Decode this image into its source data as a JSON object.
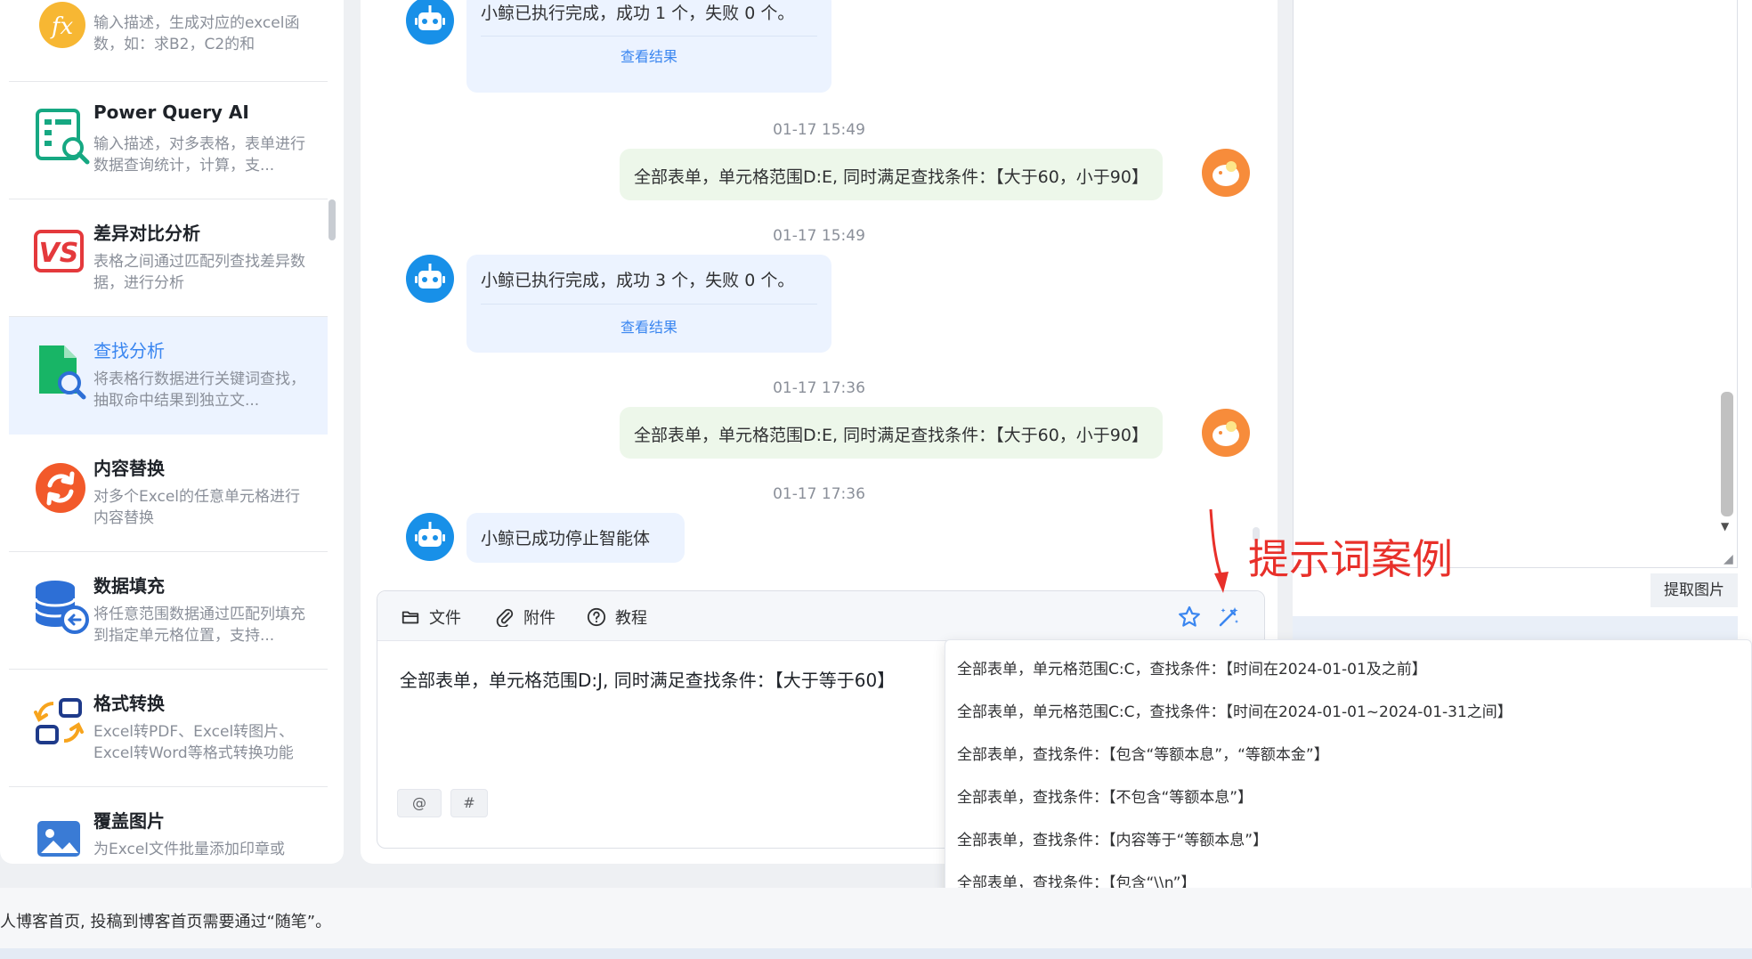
{
  "sidebar": {
    "items": [
      {
        "title": "",
        "desc": "输入描述，生成对应的excel函数，如：求B2，C2的和",
        "icon": "fx-icon",
        "color": "#f7b733"
      },
      {
        "title": "Power Query AI",
        "desc": "输入描述，对多表格，表单进行数据查询统计，计算，支...",
        "icon": "data-query-icon",
        "color": "#16a882"
      },
      {
        "title": "差异对比分析",
        "desc": "表格之间通过匹配列查找差异数据，进行分析",
        "icon": "vs-icon",
        "color": "#e4393c"
      },
      {
        "title": "查找分析",
        "desc": "将表格行数据进行关键词查找，抽取命中结果到独立文...",
        "icon": "file-search-icon",
        "color": "#18b566"
      },
      {
        "title": "内容替换",
        "desc": "对多个Excel的任意单元格进行内容替换",
        "icon": "refresh-icon",
        "color": "#f2592a"
      },
      {
        "title": "数据填充",
        "desc": "将任意范围数据通过匹配列填充到指定单元格位置，支持...",
        "icon": "database-icon",
        "color": "#2d6fd6"
      },
      {
        "title": "格式转换",
        "desc": "Excel转PDF、Excel转图片、Excel转Word等格式转换功能",
        "icon": "convert-icon",
        "color": "#1e3a8a"
      },
      {
        "title": "覆盖图片",
        "desc": "为Excel文件批量添加印章或",
        "icon": "image-icon",
        "color": "#3a7bd5"
      }
    ]
  },
  "chat": {
    "messages": [
      {
        "type": "bot",
        "text": "小鲸已执行完成，成功 1 个，失败 0 个。",
        "link": "查看结果"
      },
      {
        "type": "time",
        "text": "01-17 15:49"
      },
      {
        "type": "user",
        "text": "全部表单，单元格范围D:E, 同时满足查找条件：【大于60，小于90】"
      },
      {
        "type": "time",
        "text": "01-17 15:49"
      },
      {
        "type": "bot",
        "text": "小鲸已执行完成，成功 3 个，失败 0 个。",
        "link": "查看结果"
      },
      {
        "type": "time",
        "text": "01-17 17:36"
      },
      {
        "type": "user",
        "text": "全部表单，单元格范围D:E, 同时满足查找条件：【大于60，小于90】"
      },
      {
        "type": "time",
        "text": "01-17 17:36"
      },
      {
        "type": "bot",
        "text": "小鲸已成功停止智能体"
      }
    ],
    "toolbar": {
      "file": "文件",
      "attachment": "附件",
      "tutorial": "教程"
    },
    "input_value": "全部表单，单元格范围D:J, 同时满足查找条件：【大于等于60】",
    "tags": [
      "@",
      "#"
    ]
  },
  "right_panel": {
    "extract_button": "提取图片"
  },
  "prompt_dropdown": {
    "items": [
      "全部表单，单元格范围C:C，查找条件：【时间在2024-01-01及之前】",
      "全部表单，单元格范围C:C，查找条件：【时间在2024-01-01~2024-01-31之间】",
      "全部表单，查找条件：【包含“等额本息”，“等额本金”】",
      "全部表单，查找条件：【不包含“等额本息”】",
      "全部表单，查找条件：【内容等于“等额本息”】",
      "全部表单，查找条件：【包含“\\\\n”】"
    ]
  },
  "annotation": {
    "text": "提示词案例",
    "color": "#e8302a"
  },
  "footer": {
    "text": "人博客首页, 投稿到博客首页需要通过“随笔”。"
  },
  "colors": {
    "accent": "#3a86f0",
    "bot_bubble": "#ecf3ff",
    "user_bubble": "#edf7ea",
    "user_avatar": "#f78c3b"
  }
}
